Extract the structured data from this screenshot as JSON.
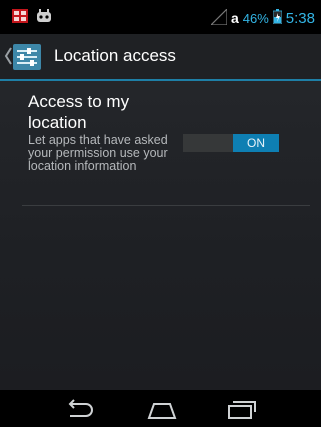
{
  "status_bar": {
    "carrier_letter": "a",
    "battery": "46%",
    "time": "5:38",
    "accent": "#33b5e5"
  },
  "action_bar": {
    "title": "Location access",
    "accent": "#1e7fa6"
  },
  "setting": {
    "title": "Access to my location",
    "summary": "Let apps that have asked your permission use your location information",
    "toggle_label": "ON",
    "toggle_on": true
  },
  "nav_bar": {
    "buttons": [
      "back-icon",
      "home-icon",
      "recents-icon"
    ]
  }
}
